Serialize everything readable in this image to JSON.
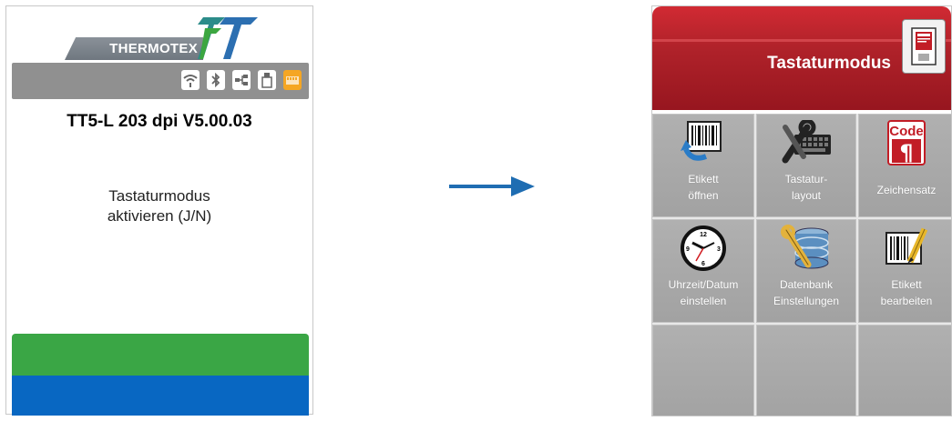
{
  "left_display": {
    "logo_text": "THERMOTEX",
    "status_icons": [
      "wifi-icon",
      "bluetooth-icon",
      "ethernet-icon",
      "usb-icon",
      "memory-card-icon"
    ],
    "model_line": "TT5-L 203 dpi V5.00.03",
    "prompt_line1": "Tastaturmodus",
    "prompt_line2": "aktivieren (J/N)",
    "colors": {
      "green_bar": "#3aa645",
      "blue_bar": "#0867c2",
      "status_bar": "#909090"
    }
  },
  "arrow": {
    "color": "#1f6db2",
    "icon": "arrow-right-icon"
  },
  "right_display": {
    "title": "Tastaturmodus",
    "title_icon": "label-document-icon",
    "header_color": "#b0222a",
    "tiles": [
      {
        "line1": "Etikett",
        "line2": "öffnen",
        "icon": "open-label-icon"
      },
      {
        "line1": "Tastatur-",
        "line2": "layout",
        "icon": "keyboard-layout-icon"
      },
      {
        "line1": "Zeichensatz",
        "line2": "",
        "icon": "code-charset-icon"
      },
      {
        "line1": "Uhrzeit/Datum",
        "line2": "einstellen",
        "icon": "clock-icon"
      },
      {
        "line1": "Datenbank",
        "line2": "Einstellungen",
        "icon": "database-settings-icon"
      },
      {
        "line1": "Etikett",
        "line2": "bearbeiten",
        "icon": "edit-label-icon"
      },
      {
        "line1": "",
        "line2": "",
        "icon": ""
      },
      {
        "line1": "",
        "line2": "",
        "icon": ""
      },
      {
        "line1": "",
        "line2": "",
        "icon": ""
      }
    ]
  }
}
